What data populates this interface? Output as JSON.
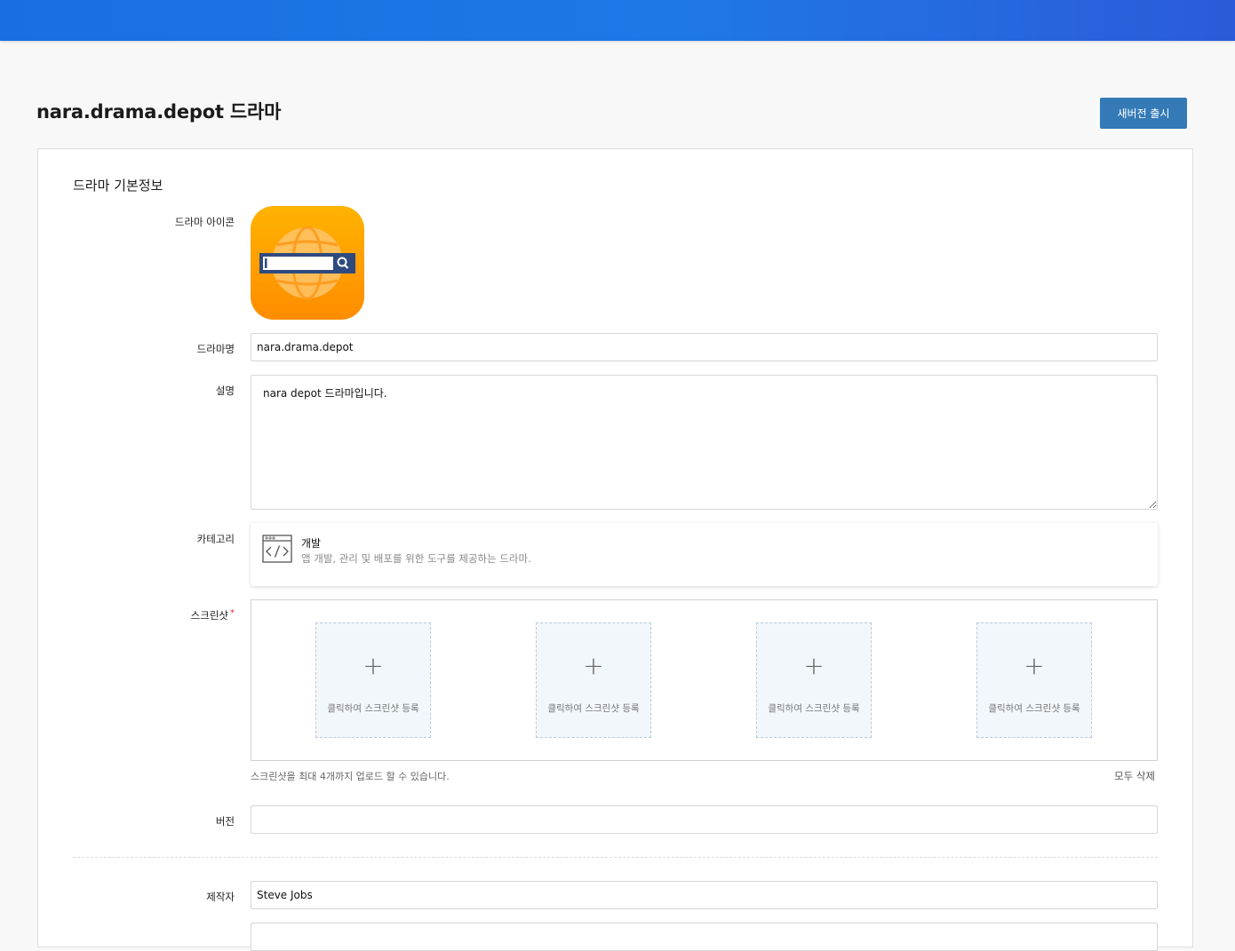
{
  "header": {
    "page_title": "nara.drama.depot 드라마",
    "release_button": "새버전 출시"
  },
  "form": {
    "section_title": "드라마 기본정보",
    "icon_label": "드라마 아이콘",
    "name_label": "드라마명",
    "name_value": "nara.drama.depot",
    "description_label": "설명",
    "description_value": "nara depot 드라마입니다.",
    "category_label": "카테고리",
    "category": {
      "name": "개발",
      "description": "앱 개발, 관리 및 배포를 위한 도구를 제공하는 드라마.",
      "icon": "code-window-icon"
    },
    "screenshot_label": "스크린샷",
    "screenshot_required": "*",
    "screenshot_slots": [
      {
        "plus": "+",
        "text": "클릭하여 스크린샷 등록"
      },
      {
        "plus": "+",
        "text": "클릭하여 스크린샷 등록"
      },
      {
        "plus": "+",
        "text": "클릭하여 스크린샷 등록"
      },
      {
        "plus": "+",
        "text": "클릭하여 스크린샷 등록"
      }
    ],
    "screenshot_hint": "스크린샷을 최대 4개까지 업로드 할 수 있습니다.",
    "delete_all": "모두 삭제",
    "version_label": "버전",
    "version_value": "",
    "author_label": "제작자",
    "author_value": "Steve Jobs"
  },
  "colors": {
    "topbar": "#1f78e6",
    "primary_button": "#337ab7",
    "icon_orange": "#ff9800",
    "required": "#e02b2b"
  }
}
